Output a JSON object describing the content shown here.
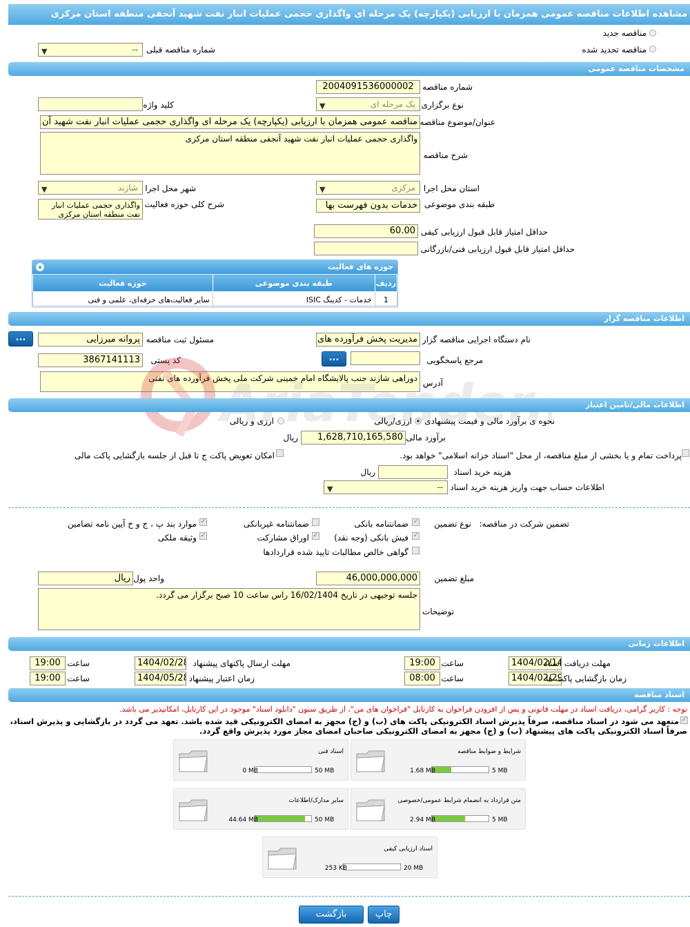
{
  "page_title": "مشاهده اطلاعات مناقصه عمومی همزمان با ارزیابی (یکپارچه) یک مرحله ای واگذاری حجمی عملیات انبار نفت شهید آنجفی منطقه استان مرکزی",
  "tender_type": {
    "new_label": "مناقصه جدید",
    "renewed_label": "مناقصه تجدید شده",
    "prev_number_label": "شماره مناقصه قبلی",
    "prev_number_value": "--"
  },
  "general": {
    "section_title": "مشخصات مناقصه عمومی",
    "number_label": "شماره مناقصه",
    "number_value": "2004091536000002",
    "holding_type_label": "نوع برگزاری",
    "holding_type_value": "یک مرحله ای",
    "keyword_label": "کلید واژه",
    "keyword_value": "",
    "subject_label": "عنوان/موضوع مناقصه",
    "subject_value": "مناقصه عمومی همزمان با ارزیابی (یکپارچه) یک مرحله ای واگذاری حجمی عملیات انبار نفت شهید آن",
    "description_label": "شرح مناقصه",
    "description_value": "واگذاری حجمی عملیات انبار نفت شهید آنجفی منطقه استان مرکزی",
    "province_label": "استان محل اجرا",
    "province_value": "مرکزی",
    "city_label": "شهر محل اجرا",
    "city_value": "شازند",
    "category_label": "طبقه بندی موضوعی",
    "category_value": "خدمات بدون فهرست بها",
    "activity_desc_label": "شرح کلی حوزه فعالیت",
    "activity_desc_value": "واگذاری حجمی عملیات انبار نفت منطقه استان مرکزی",
    "min_quality_label": "حداقل امتیاز قابل قبول ارزیابی کیفی",
    "min_quality_value": "60.00",
    "min_tech_label": "حداقل امتیاز قابل قبول ارزیابی فنی/بازرگانی",
    "min_tech_value": ""
  },
  "activity_table": {
    "title": "حوزه های فعالیت",
    "headers": [
      "ردیف",
      "طبقه بندی موضوعی",
      "حوزه فعالیت"
    ],
    "rows": [
      [
        "1",
        "خدمات - کدینگ ISIC",
        "سایر فعالیت‌های حرفه‌ای، علمی و فنی"
      ]
    ]
  },
  "organizer": {
    "section_title": "اطلاعات مناقصه گزار",
    "org_label": "نام دستگاه اجرایی مناقصه گزار",
    "org_value": "مدیریت پخش فرآورده های نفتی",
    "officer_label": "مسئول ثبت مناقصه",
    "officer_value": "پروانه  میرزایی",
    "ref_label": "مرجع پاسخگویی",
    "ref_value": "",
    "postal_label": "کد پستی",
    "postal_value": "3867141113",
    "address_label": "آدرس",
    "address_value": "دوراهی شازند جنب پالایشگاه امام خمینی شرکت ملی پخش فرآورده های نفتی",
    "more_button": "..."
  },
  "finance": {
    "section_title": "اطلاعات مالی/تامین اعتبار",
    "estimate_method_label": "نحوه ی برآورد مالی و قیمت پیشنهادی",
    "opt_currency": "ارزی/ریالی",
    "opt_currency_rial": "ارزی و ریالی",
    "estimate_label": "برآورد مالی",
    "estimate_value": "1,628,710,165,580",
    "estimate_unit": "ریال",
    "treasury_label": "پرداخت تمام و یا بخشی از مبلغ مناقصه، از محل \"اسناد خزانه اسلامی\" خواهد بود.",
    "swap_label": "امکان تعویض پاکت ج تا قبل از جلسه بازگشایی پاکت مالی",
    "doc_cost_label": "هزینه خرید اسناد",
    "doc_cost_value": "",
    "doc_cost_unit": "ریال",
    "account_label": "اطلاعات حساب جهت واریز هزینه خرید اسناد",
    "account_value": "--"
  },
  "guarantee": {
    "label": "تضمین شرکت در مناقصه:",
    "type_label": "نوع تضمین",
    "options": {
      "bank_guarantee": "ضمانتنامه بانکی",
      "non_bank_guarantee": "ضمانتنامه غیربانکی",
      "articles": "موارد بند پ ، ج و خ آیین نامه تضامین",
      "cash": "فیش بانکی (وجه نقد)",
      "bonds": "اوراق مشارکت",
      "property": "وثیقه ملکی",
      "claims": "گواهی خالص مطالبات تایید شده قراردادها"
    },
    "amount_label": "مبلغ تضمین",
    "amount_value": "46,000,000,000",
    "currency_label": "واحد پول",
    "currency_value": "ریال",
    "notes_label": "توضیحات",
    "notes_value": "جلسه توجیهی در تاریخ 16/02/1404 راس ساعت 10 صبح برگزار  می گردد."
  },
  "timing": {
    "section_title": "اطلاعات زمانی",
    "receive_label": "مهلت دریافت اسناد",
    "receive_date": "1404/02/14",
    "receive_time": "19:00",
    "send_label": "مهلت ارسال پاکتهای پیشنهاد",
    "send_date": "1404/02/28",
    "send_time": "19:00",
    "open_label": "زمان بازگشایی پاکت ها",
    "open_date": "1404/02/29",
    "open_time": "08:00",
    "validity_label": "زمان اعتبار پیشنهاد",
    "validity_date": "1404/05/28",
    "validity_time": "19:00",
    "time_label": "ساعت"
  },
  "documents": {
    "section_title": "اسناد مناقصه",
    "note_red": "توجه : کاربر گرامی، دریافت اسناد در مهلت قانونی و پس از افزودن فراخوان به کارتابل \"فراخوان های من\"، از طریق ستون \"دانلود اسناد\" موجود در این کارتابل، امکانپذیر می باشد.",
    "note_bold_1": "متعهد می شود در اسناد مناقصه، صرفاً پذیرش اسناد الکترونیکی پاکت های (ب) و (ج) مجهز به امضای الکترونیکی قید شده باشد. تعهد می گردد در بازگشایی و پذیرش اسناد،",
    "note_bold_2": "صرفاً اسناد الکترونیکی پاکت های پیشنهاد (ب) و (ج) مجهز به امضای الکترونیکی صاحبان امضای مجاز مورد پذیرش واقع گردد.",
    "items": [
      {
        "name": "شرایط و ضوابط مناقصه",
        "used": "1.68 MB",
        "max": "5 MB",
        "fill": 0.34
      },
      {
        "name": "اسناد فنی",
        "used": "0 MB",
        "max": "50 MB",
        "fill": 0.0
      },
      {
        "name": "متن قرارداد به انضمام شرایط عمومی/خصوصی",
        "used": "2.94 MB",
        "max": "5 MB",
        "fill": 0.59
      },
      {
        "name": "سایر مدارک/اطلاعات",
        "used": "44.64 MB",
        "max": "50 MB",
        "fill": 0.89
      },
      {
        "name": "اسناد ارزیابی کیفی",
        "used": "253 KB",
        "max": "20 MB",
        "fill": 0.01
      }
    ]
  },
  "buttons": {
    "print": "چاپ",
    "back": "بازگشت"
  },
  "watermark": "AriaTender.neT"
}
